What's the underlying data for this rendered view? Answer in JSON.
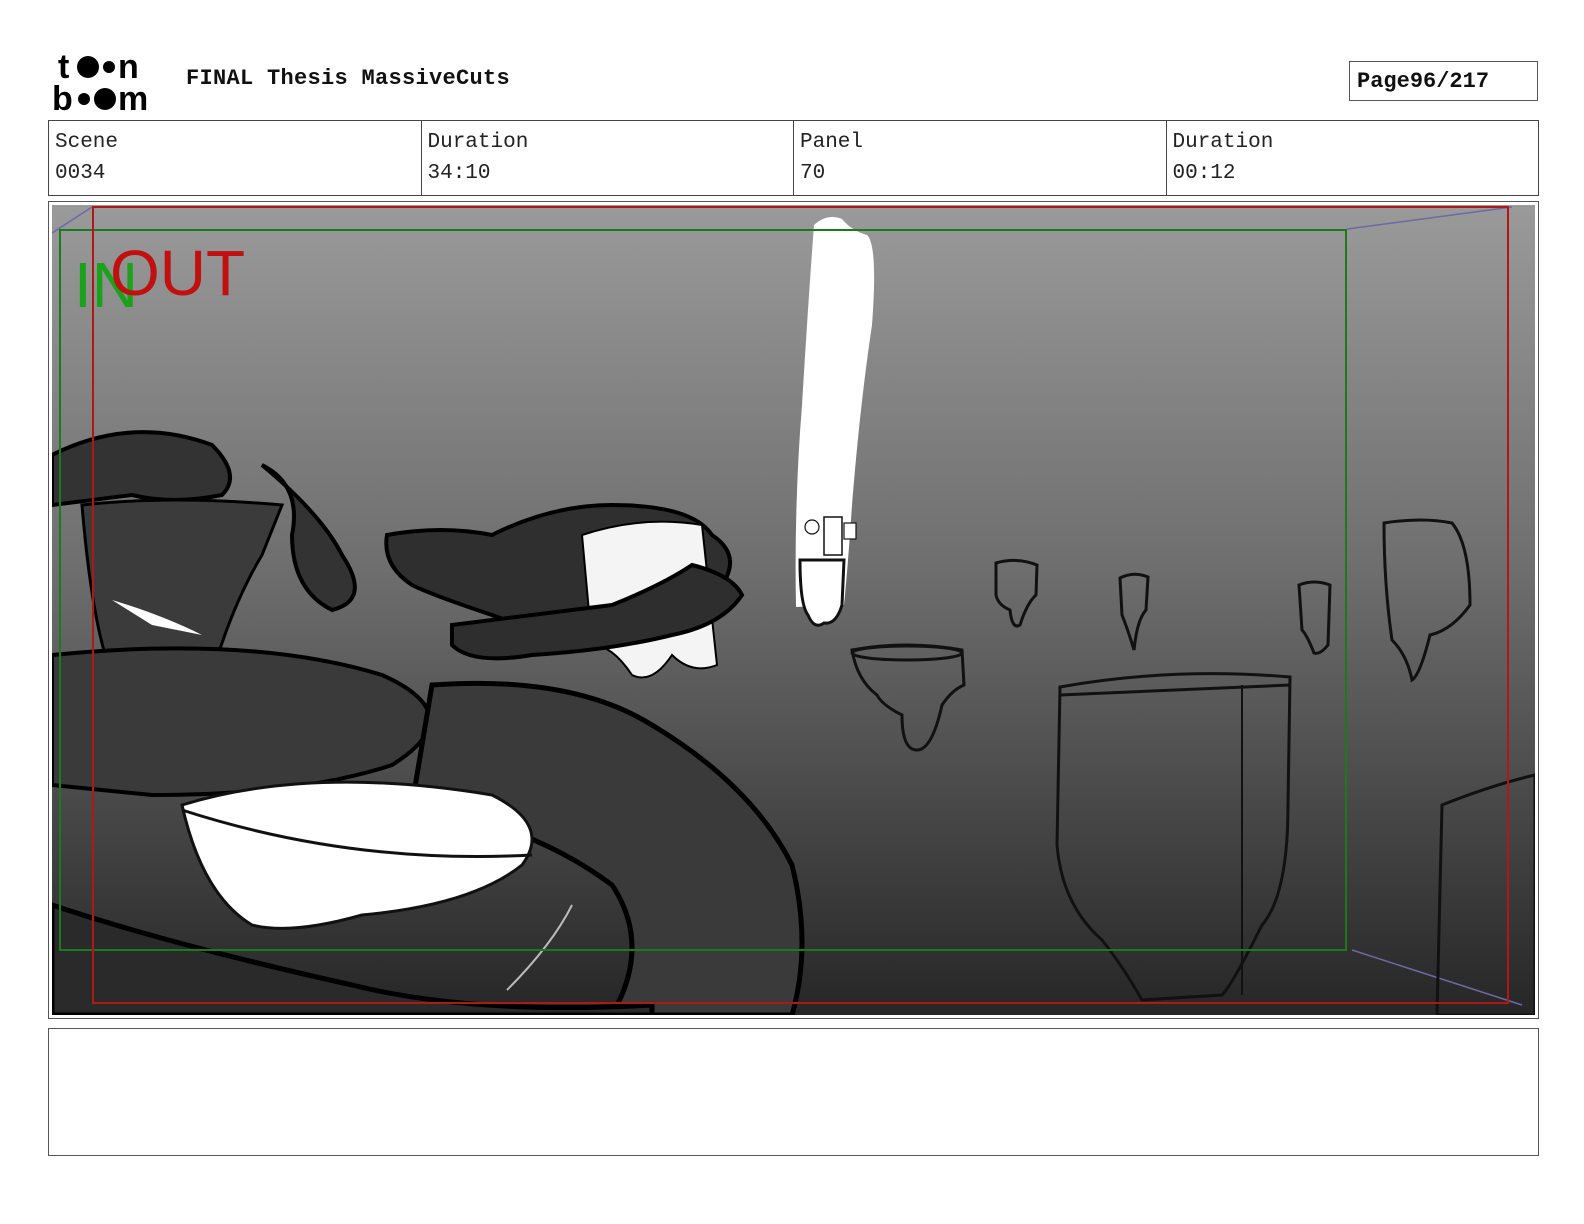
{
  "header": {
    "logo_text": "toon boom",
    "title": "FINAL Thesis MassiveCuts",
    "page_label": "Page",
    "page_value": "96/217"
  },
  "info": {
    "scene_label": "Scene",
    "scene_value": "0034",
    "scene_duration_label": "Duration",
    "scene_duration_value": "34:10",
    "panel_label": "Panel",
    "panel_value": "70",
    "panel_duration_label": "Duration",
    "panel_duration_value": "00:12"
  },
  "panel": {
    "in_marker": "IN",
    "out_marker": "OUT",
    "in_color": "#1aa31a",
    "out_color": "#c01010"
  },
  "notes": {
    "text": ""
  }
}
